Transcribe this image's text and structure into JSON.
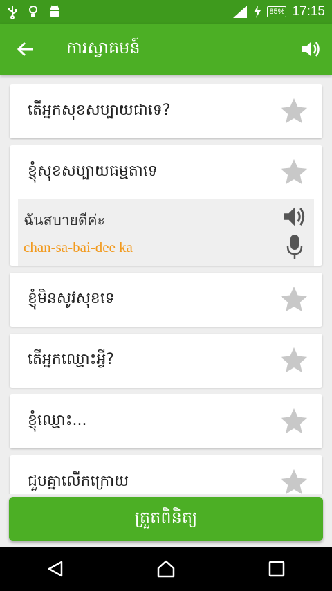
{
  "status_bar": {
    "battery": "85%",
    "time": "17:15",
    "icons": [
      "usb-icon",
      "bulb-icon",
      "android-icon",
      "signal-icon",
      "charging-icon",
      "battery-icon"
    ]
  },
  "app_bar": {
    "title": "ការស្វាគមន៍",
    "back_icon": "arrow-back-icon",
    "sound_icon": "volume-icon"
  },
  "phrases": [
    {
      "text": "តើអ្នកសុខសប្បាយជាទេ?"
    },
    {
      "text": "ខ្ញុំសុខសប្បាយធម្មតាទេ",
      "translation": "ฉันสบายดีค่ะ",
      "romanized": "chan-sa-bai-dee ka"
    },
    {
      "text": "ខ្ញុំមិនសូវសុខទេ"
    },
    {
      "text": "តើអ្នកឈ្មោះអ្វី?"
    },
    {
      "text": "ខ្ញុំឈ្មោះ..."
    },
    {
      "text": "ជួបគ្នាលើកក្រោយ"
    }
  ],
  "check_button": {
    "label": "ត្រួតពិនិត្យ"
  },
  "colors": {
    "status_bar": "#3e9a1d",
    "app_bar": "#4caf25",
    "romanized": "#f29a1e",
    "star": "#c8c8c8"
  }
}
